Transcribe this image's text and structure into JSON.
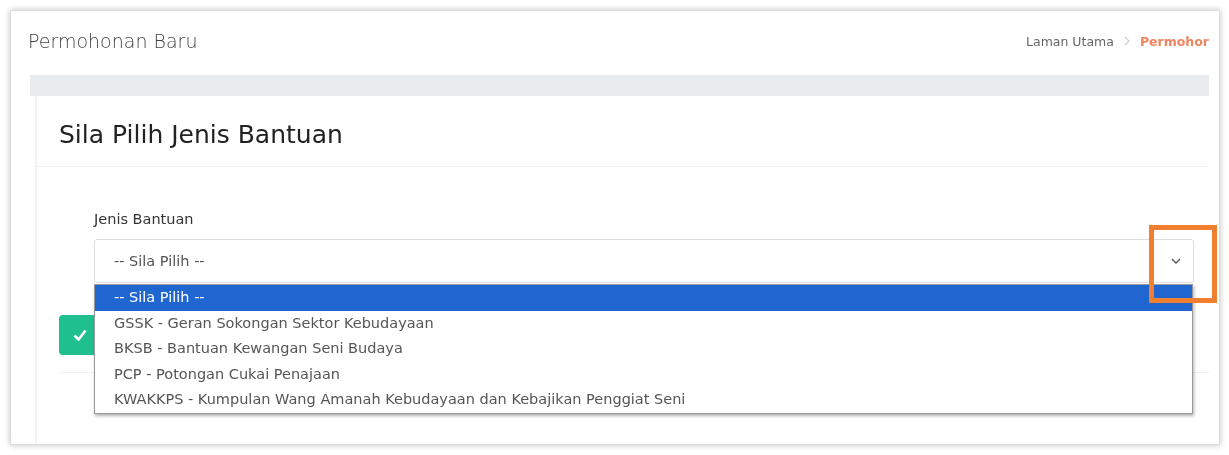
{
  "page": {
    "title": "Permohonan Baru"
  },
  "breadcrumb": [
    {
      "label": "Laman Utama",
      "current": false
    },
    {
      "label": "Permohor",
      "current": true
    }
  ],
  "card": {
    "title": "Sila Pilih Jenis Bantuan"
  },
  "field": {
    "label": "Jenis Bantuan",
    "value": "-- Sila Pilih --",
    "expanded": true
  },
  "options": [
    {
      "label": "-- Sila Pilih --",
      "selected": true
    },
    {
      "label": "GSSK - Geran Sokongan Sektor Kebudayaan",
      "selected": false
    },
    {
      "label": "BKSB - Bantuan Kewangan Seni Budaya",
      "selected": false
    },
    {
      "label": "PCP - Potongan Cukai Penajaan",
      "selected": false
    },
    {
      "label": "KWAKKPS - Kumpulan Wang Amanah Kebudayaan dan Kebajikan Penggiat Seni",
      "selected": false
    }
  ]
}
